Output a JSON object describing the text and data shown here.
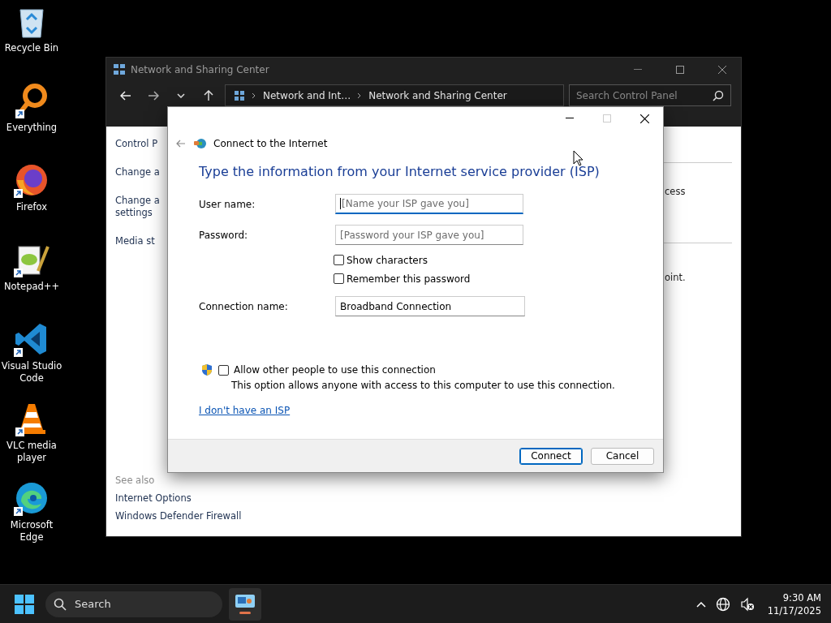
{
  "desktop_icons": [
    {
      "label": "Recycle Bin",
      "kind": "recycle",
      "shortcut": false
    },
    {
      "label": "Everything",
      "kind": "magnifier",
      "shortcut": true
    },
    {
      "label": "Firefox",
      "kind": "fox",
      "shortcut": true
    },
    {
      "label": "Notepad++",
      "kind": "notepad",
      "shortcut": true
    },
    {
      "label": "Visual Studio Code",
      "kind": "code",
      "shortcut": true
    },
    {
      "label": "VLC media player",
      "kind": "cone",
      "shortcut": true
    },
    {
      "label": "Microsoft Edge",
      "kind": "edge",
      "shortcut": true
    }
  ],
  "background_window": {
    "title": "Network and Sharing Center",
    "breadcrumb": [
      "Network and Int…",
      "Network and Sharing Center"
    ],
    "search": {
      "placeholder": "Search Control Panel"
    },
    "left_pane": [
      "Control P",
      "Change a",
      "Change a settings",
      "Media st"
    ],
    "right_pane": [
      "cess",
      "oint."
    ],
    "see_also": {
      "heading": "See also",
      "links": [
        "Internet Options",
        "Windows Defender Firewall"
      ]
    }
  },
  "dialog": {
    "title": "Connect to the Internet",
    "maximize_disabled": true,
    "heading": "Type the information from your Internet service provider (ISP)",
    "fields": [
      {
        "label": "User name:",
        "placeholder": "[Name your ISP gave you]",
        "focused": true
      },
      {
        "label": "Password:",
        "placeholder": "[Password your ISP gave you]",
        "focused": false
      }
    ],
    "options": [
      {
        "label": "Show characters",
        "checked": false
      },
      {
        "label": "Remember this password",
        "checked": false
      }
    ],
    "connection_name": {
      "label": "Connection name:",
      "value": "Broadband Connection"
    },
    "share": {
      "label": "Allow other people to use this connection",
      "checked": false,
      "description": "This option allows anyone with access to this computer to use this connection."
    },
    "link": "I don't have an ISP",
    "buttons": [
      {
        "label": "Connect",
        "default": true
      },
      {
        "label": "Cancel",
        "default": false
      }
    ]
  },
  "taskbar": {
    "search": {
      "placeholder": "Search"
    },
    "app_active": true,
    "time": "9:30 AM",
    "date": "11/17/2025"
  }
}
